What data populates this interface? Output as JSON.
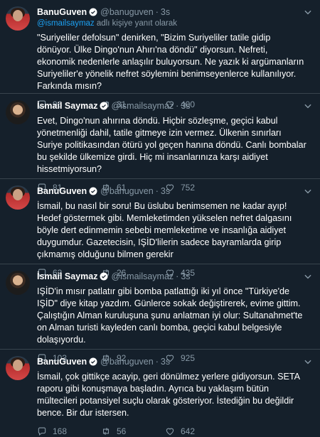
{
  "tweets": [
    {
      "name": "BanuGuven",
      "handle": "@banuguven",
      "time": "3s",
      "reply_to_user": "@ismailsaymaz",
      "reply_to_suffix": "adlı kişiye yanıt olarak",
      "text": "\"Suriyeliler defolsun\" denirken, \"Bizim Suriyeliler tatile gidip dönüyor. Ülke Dingo'nun Ahırı'na döndü\" diyorsun. Nefreti, ekonomik nedenlerle anlaşılır buluyorsun. Ne yazık ki argümanların Suriyeliler'e yönelik nefret söylemini benimseyenlerce kullanılıyor. Farkında mısın?",
      "replies": "96",
      "retweets": "31",
      "likes": "400"
    },
    {
      "name": "İsmail Saymaz",
      "handle": "@ismailsaymaz",
      "time": "3s",
      "text": "Evet, Dingo'nun ahırına döndü. Hiçbir sözleşme, geçici kabul yönetmenliği dahil, tatile gitmeye izin vermez. Ülkenin sınırları Suriye politikasından ötürü yol geçen hanına döndü. Canlı bombalar bu şekilde ülkemize girdi. Hiç mi insanlarınıza karşı aidiyet hissetmiyorsun?",
      "replies": "81",
      "retweets": "61",
      "likes": "752"
    },
    {
      "name": "BanuGuven",
      "handle": "@banuguven",
      "time": "3s",
      "text": "İsmail, bu nasıl bir soru! Bu üslubu benimsemen ne kadar ayıp! Hedef göstermek gibi. Memleketimden yükselen nefret dalgasını böyle dert edinmemin sebebi memleketime ve insanlığa aidiyet duygumdur. Gazetecisin, IŞİD'lilerin sadece bayramlarda girip çıkmamış olduğunu bilmen gerekir",
      "replies": "62",
      "retweets": "26",
      "likes": "435"
    },
    {
      "name": "İsmail Saymaz",
      "handle": "@ismailsaymaz",
      "time": "3s",
      "text": "IŞİD'in mısır patlatır gibi bomba patlattığı iki yıl önce \"Türkiye'de IŞİD\" diye kitap yazdım. Günlerce sokak değiştirerek, evime gittim. Çalıştığın Alman kuruluşuna şunu anlatman iyi olur: Sultanahmet'te on Alman turisti kayleden canlı bomba, geçici kabul belgesiyle dolaşıyordu.",
      "replies": "103",
      "retweets": "92",
      "likes": "925"
    },
    {
      "name": "BanuGuven",
      "handle": "@banuguven",
      "time": "3s",
      "text": "İsmail, çok gittikçe acayip, geri dönülmez yerlere gidiyorsun. SETA raporu gibi konuşmaya başladın. Ayrıca bu yaklaşım bütün mültecileri potansiyel suçlu olarak gösteriyor. İstediğin bu değildir bence. Bir dur istersen.",
      "replies": "168",
      "retweets": "56",
      "likes": "642"
    }
  ],
  "icons": {
    "verified": "verified-badge-icon",
    "caret": "chevron-down-icon",
    "reply": "reply-icon",
    "retweet": "retweet-icon",
    "like": "heart-icon"
  },
  "colors": {
    "background": "#15202b",
    "divider": "#38444d",
    "muted": "#8899a6",
    "accent": "#1da1f2"
  }
}
